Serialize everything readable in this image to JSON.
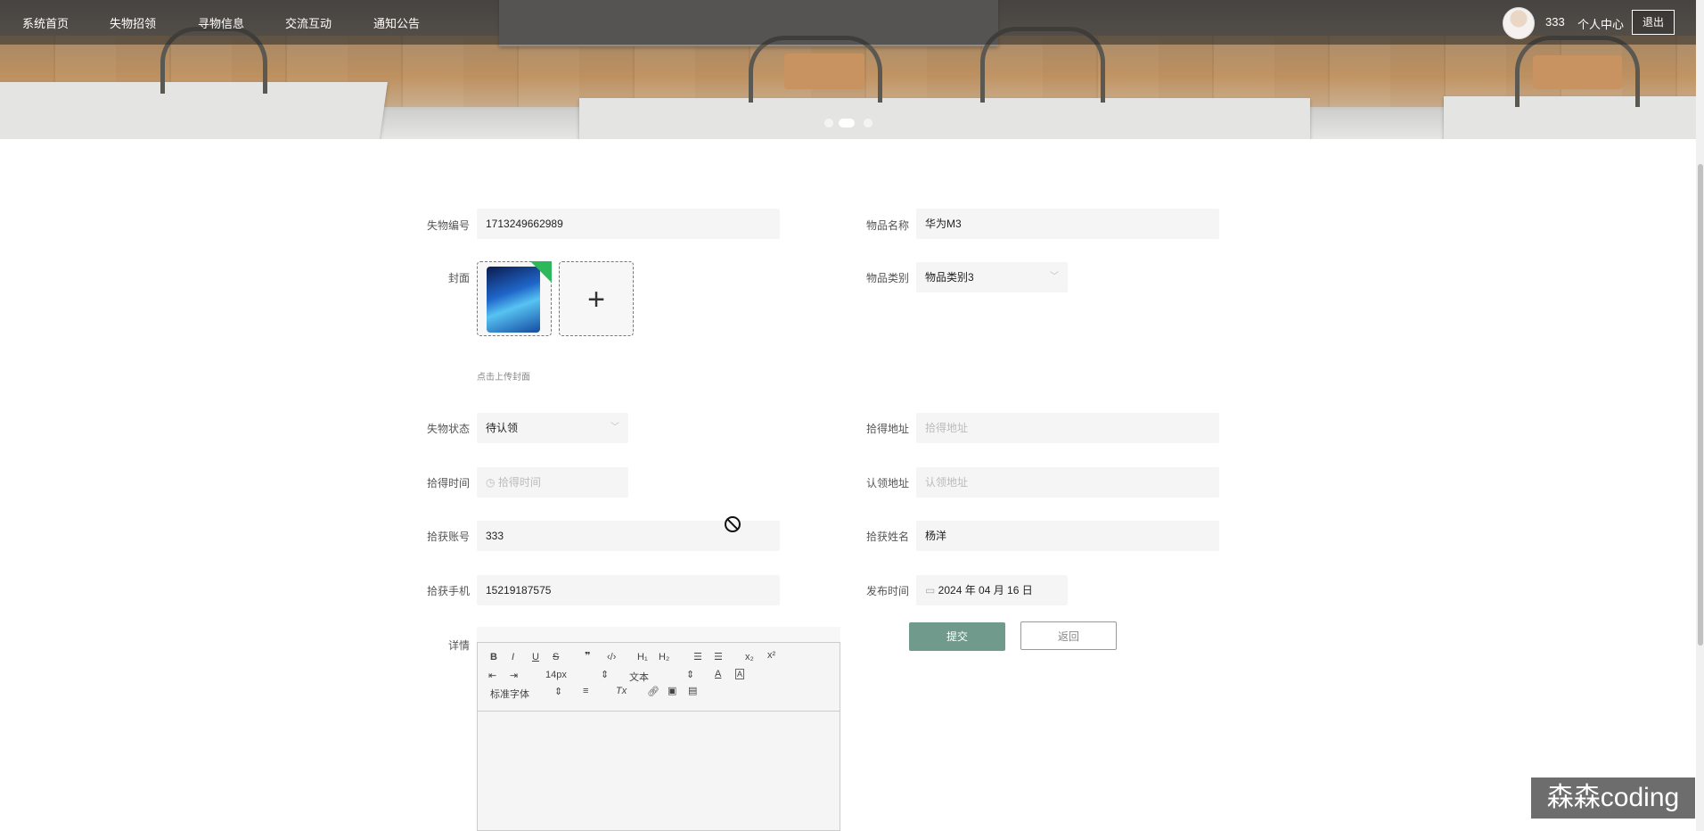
{
  "nav": {
    "items": [
      "系统首页",
      "失物招领",
      "寻物信息",
      "交流互动",
      "通知公告"
    ],
    "username": "333",
    "profile": "个人中心",
    "logout": "退出"
  },
  "form": {
    "lost_id": {
      "label": "失物编号",
      "value": "1713249662989"
    },
    "item_name": {
      "label": "物品名称",
      "value": "华为M3"
    },
    "cover": {
      "label": "封面",
      "hint": "点击上传封面"
    },
    "category": {
      "label": "物品类别",
      "value": "物品类别3"
    },
    "status": {
      "label": "失物状态",
      "value": "待认领"
    },
    "found_place": {
      "label": "拾得地址",
      "placeholder": "拾得地址"
    },
    "found_time": {
      "label": "拾得时间",
      "placeholder": "拾得时间"
    },
    "claim_place": {
      "label": "认领地址",
      "placeholder": "认领地址"
    },
    "finder_account": {
      "label": "拾获账号",
      "value": "333"
    },
    "finder_name": {
      "label": "拾获姓名",
      "value": "杨洋"
    },
    "finder_phone": {
      "label": "拾获手机",
      "value": "15219187575"
    },
    "publish_time": {
      "label": "发布时间",
      "value": "2024 年 04 月 16 日"
    },
    "details": {
      "label": "详情"
    },
    "submit": "提交",
    "back": "返回"
  },
  "editor": {
    "font_size": "14px",
    "header_type": "文本",
    "font_family": "标准字体"
  },
  "watermark": "森森coding"
}
